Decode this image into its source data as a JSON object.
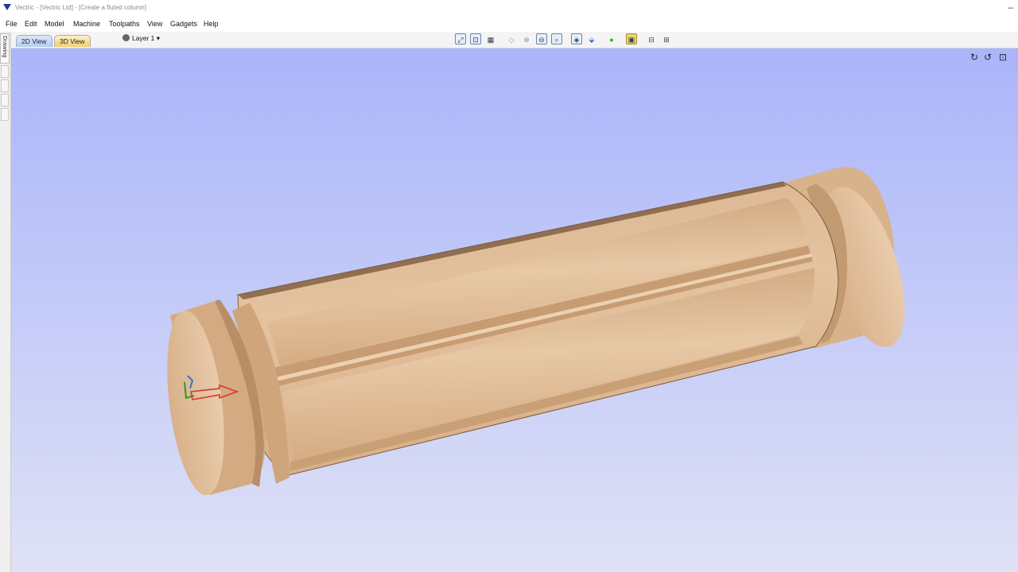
{
  "window": {
    "title": "Vectric - [Vectric Ltd] - [Create a fluted column]"
  },
  "menu": [
    "File",
    "Edit",
    "Model",
    "Machine",
    "Toolpaths",
    "View",
    "Gadgets",
    "Help"
  ],
  "tabs": {
    "view2d": "2D View",
    "view3d": "3D View"
  },
  "layer": {
    "label": "Layer 1"
  },
  "sidebar": {
    "drawing_tab": "Drawing"
  },
  "colors": {
    "wood": "#dcb68f",
    "wood_dark": "#b08660",
    "background_top": "#aab5fa",
    "background_bottom": "#dfe1f6",
    "tab_active": "#f2cf72"
  },
  "icons": {
    "toolbar": [
      "zoom-fit-icon",
      "zoom-box-icon",
      "grid-icon",
      "view-iso-icon",
      "zoom-in-icon",
      "zoom-out-icon",
      "zoom-window-icon",
      "rotate-view-icon",
      "flip-view-icon",
      "render-icon",
      "material-icon",
      "split-view-icon",
      "tile-view-icon"
    ],
    "viewport": [
      "rotate-cw-icon",
      "rotate-ccw-icon",
      "reset-view-icon"
    ]
  }
}
